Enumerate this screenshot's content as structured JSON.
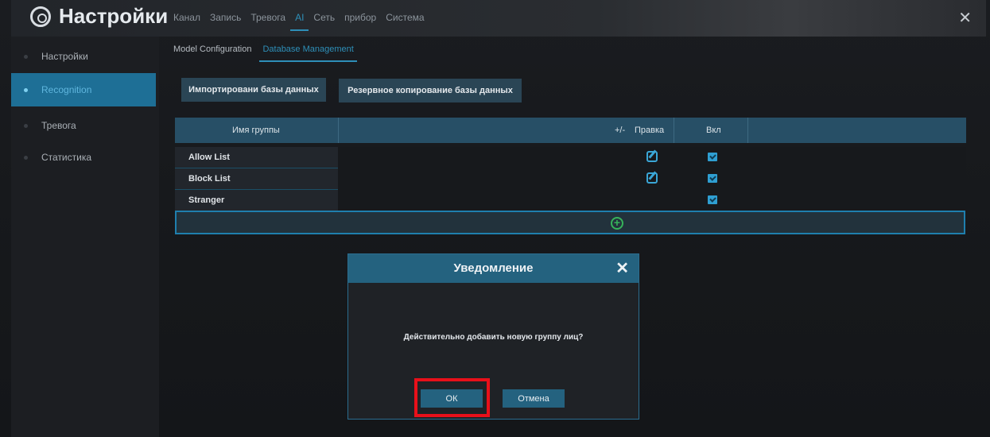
{
  "app": {
    "title": "Настройки",
    "close_icon": "close-icon",
    "settings_icon": "gear-icon"
  },
  "top_tabs": [
    "Канал",
    "Запись",
    "Тревога",
    "AI",
    "Сеть",
    "прибор",
    "Система"
  ],
  "top_tabs_active": "AI",
  "sidebar": {
    "items": [
      "Настройки",
      "Recognition",
      "Тревога",
      "Статистика"
    ],
    "active": "Recognition"
  },
  "subtabs": [
    "Model Configuration",
    "Database Management"
  ],
  "subtabs_active": "Database Management",
  "buttons": {
    "import": "Импортировани базы данных",
    "backup": "Резервное копирование базы данных"
  },
  "table": {
    "headers": [
      "Имя группы",
      "+/-",
      "Правка",
      "Вкл"
    ],
    "rows": [
      {
        "name": "Allow List",
        "editable": true,
        "enabled": true
      },
      {
        "name": "Block List",
        "editable": true,
        "enabled": true
      },
      {
        "name": "Stranger",
        "editable": false,
        "enabled": true
      }
    ],
    "add_icon": "plus-circle-icon"
  },
  "dialog": {
    "title": "Уведомление",
    "message": "Действительно добавить новую группу лиц?",
    "ok_label": "ОК",
    "cancel_label": "Отмена"
  },
  "colors": {
    "accent": "#2e8fb8",
    "highlight": "#e8101a",
    "add": "#36b35a"
  }
}
